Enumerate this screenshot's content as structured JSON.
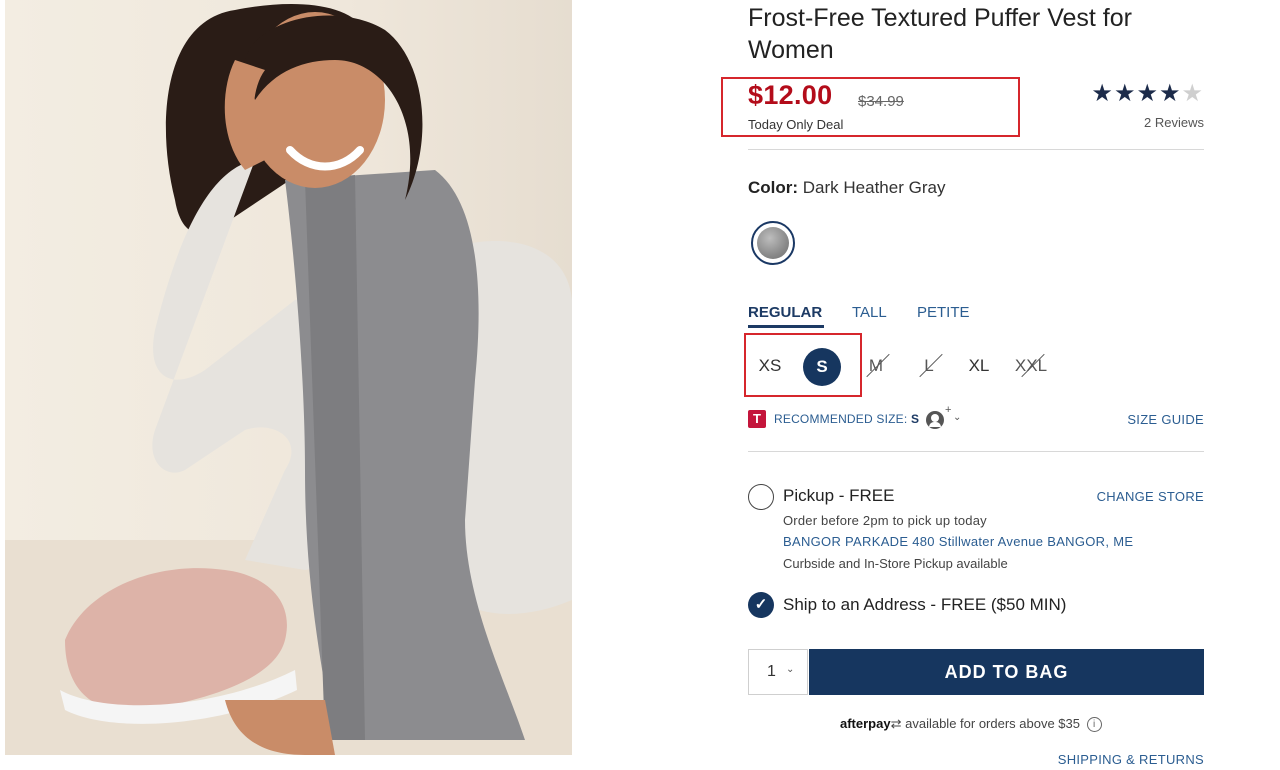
{
  "product": {
    "title": "Frost-Free Textured Puffer Vest for Women",
    "sale_price": "$12.00",
    "original_price": "$34.99",
    "deal_label": "Today Only Deal",
    "rating": {
      "filled": 4,
      "total": 5,
      "reviews_label": "2 Reviews"
    }
  },
  "color": {
    "label": "Color:",
    "value": "Dark Heather Gray"
  },
  "fit_tabs": [
    "REGULAR",
    "TALL",
    "PETITE"
  ],
  "sizes": [
    {
      "label": "XS",
      "state": "available"
    },
    {
      "label": "S",
      "state": "selected"
    },
    {
      "label": "M",
      "state": "unavailable"
    },
    {
      "label": "L",
      "state": "unavailable"
    },
    {
      "label": "XL",
      "state": "available"
    },
    {
      "label": "XXL",
      "state": "unavailable"
    }
  ],
  "recommendation": {
    "badge": "T",
    "label": "RECOMMENDED SIZE:",
    "value": "S",
    "plus": "+",
    "size_guide": "SIZE GUIDE"
  },
  "fulfillment": {
    "pickup_label": "Pickup - FREE",
    "change_store": "CHANGE STORE",
    "order_before": "Order before 2pm to pick up today",
    "store_address": "BANGOR PARKADE 480 Stillwater Avenue  BANGOR, ME",
    "curbside": "Curbside and In-Store Pickup available",
    "ship_label": "Ship to an Address - FREE ($50 MIN)"
  },
  "purchase": {
    "quantity": "1",
    "add_to_bag": "ADD TO BAG",
    "afterpay_logo": "afterpay",
    "afterpay_text": "available for orders above $35",
    "shipping_returns": "SHIPPING & RETURNS"
  },
  "colors": {
    "accent_navy": "#16365f",
    "sale_red": "#b30c1a",
    "highlight_red": "#d6262c",
    "link_blue": "#2b5d91"
  }
}
